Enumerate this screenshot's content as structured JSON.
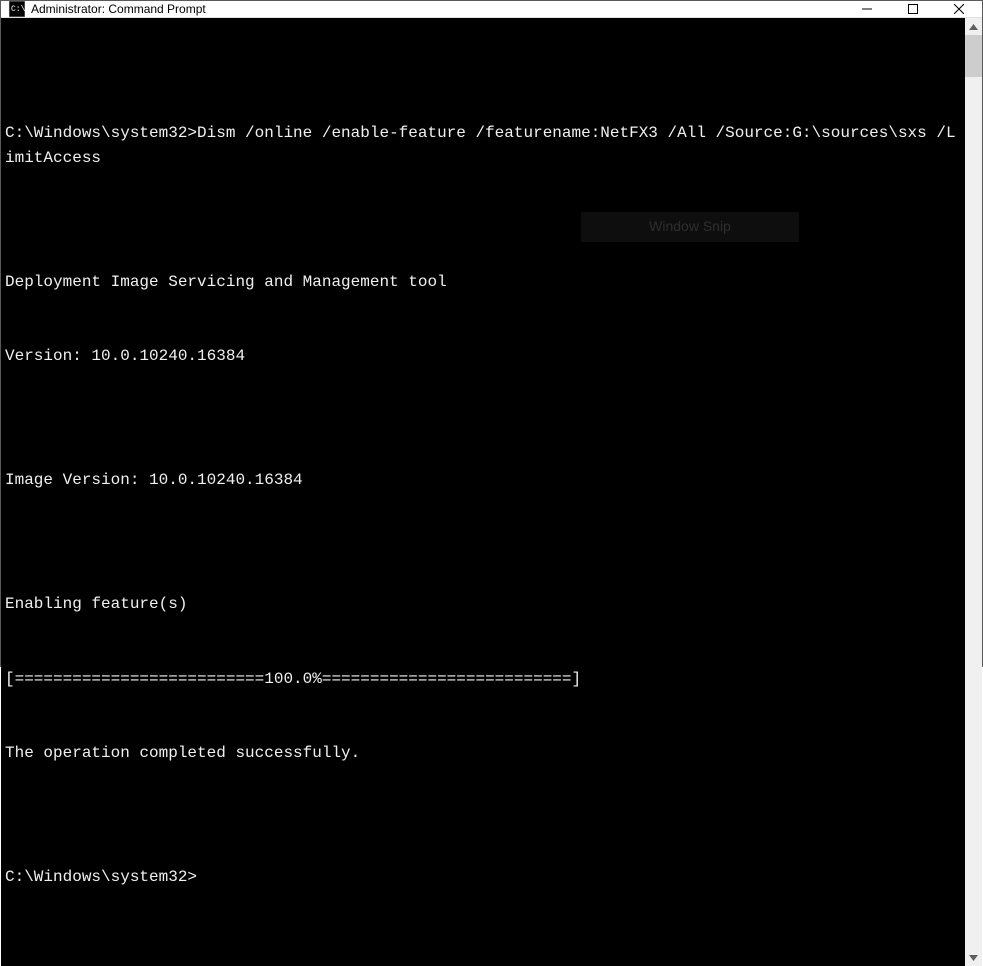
{
  "window": {
    "title": "Administrator: Command Prompt"
  },
  "snip": {
    "label": "Window Snip"
  },
  "terminal": {
    "lines": [
      "",
      "C:\\Windows\\system32>Dism /online /enable-feature /featurename:NetFX3 /All /Source:G:\\sources\\sxs /LimitAccess",
      "",
      "Deployment Image Servicing and Management tool",
      "Version: 10.0.10240.16384",
      "",
      "Image Version: 10.0.10240.16384",
      "",
      "Enabling feature(s)",
      "[==========================100.0%==========================]",
      "The operation completed successfully.",
      "",
      "C:\\Windows\\system32>"
    ]
  }
}
